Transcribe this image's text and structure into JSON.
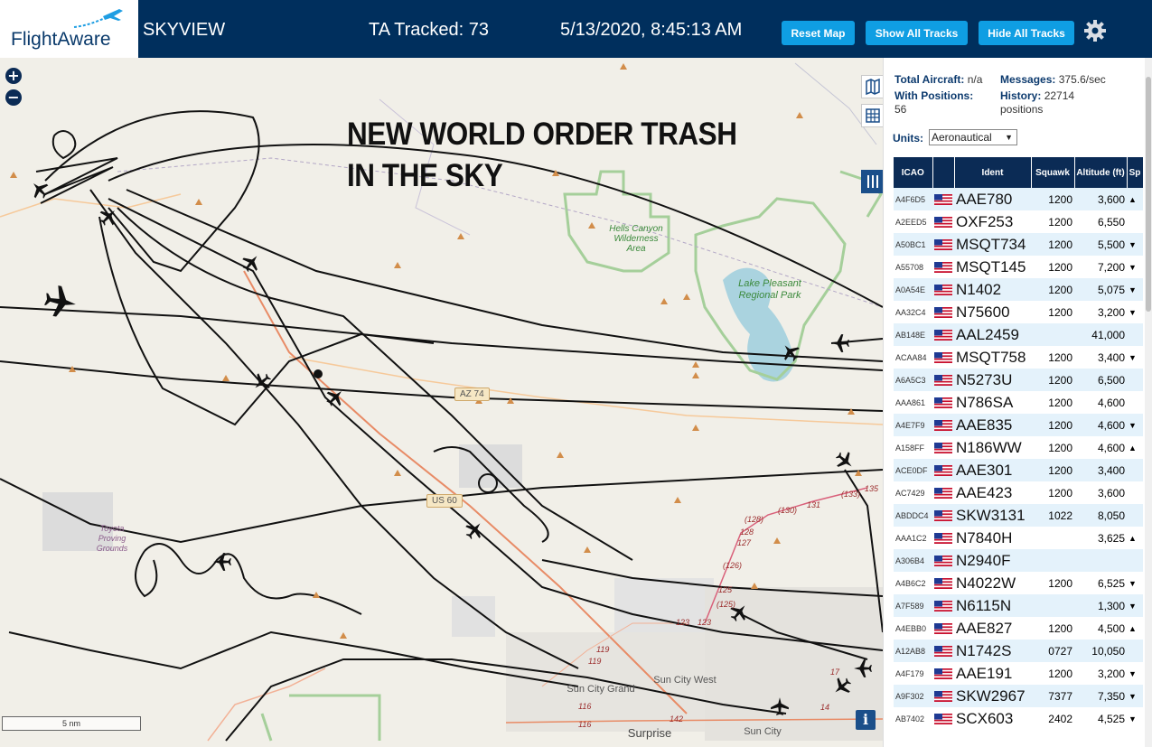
{
  "header": {
    "logo_text": "FlightAware",
    "app_title": "SKYVIEW",
    "tracked": "TA Tracked: 73",
    "datetime": "5/13/2020, 8:45:13 AM",
    "buttons": {
      "reset_map": "Reset Map",
      "show_all_tracks": "Show All Tracks",
      "hide_all_tracks": "Hide All Tracks"
    },
    "colors": {
      "bar": "#002f5d",
      "button": "#0f9ee3"
    }
  },
  "map": {
    "zoom_in": "+",
    "zoom_out": "−",
    "overlay_line1": "NEW WORLD ORDER TRASH",
    "overlay_line2": "IN THE SKY",
    "labels": {
      "hells_canyon": "Hells Canyon Wilderness Area",
      "lake_pleasant": "Lake Pleasant Regional Park",
      "toyota": "Toyota Proving Grounds",
      "sun_city_grand": "Sun City Grand",
      "sun_city_west": "Sun City West",
      "surprise": "Surprise",
      "sun_city": "Sun City"
    },
    "roads": {
      "az74": "AZ 74",
      "us60": "US 60"
    },
    "road_numbers": [
      "(133)",
      "(130)",
      "131",
      "(128)",
      "128",
      "127",
      "(126)",
      "125",
      "(125)",
      "123",
      "123",
      "119",
      "119",
      "116",
      "116",
      "142",
      "17",
      "14",
      "135"
    ],
    "scale": "5 nm",
    "info": "i",
    "icons": [
      "map-layer-icon",
      "grid-icon",
      "columns-icon",
      "airplane-icon"
    ]
  },
  "sidebar": {
    "total_aircraft_label": "Total Aircraft:",
    "total_aircraft_value": "n/a",
    "with_positions_label": "With Positions:",
    "with_positions_value": "56",
    "messages_label": "Messages:",
    "messages_value": "375.6/sec",
    "history_label": "History:",
    "history_value": "22714 positions",
    "units_label": "Units:",
    "units_value": "Aeronautical",
    "columns": [
      "ICAO",
      "",
      "Ident",
      "Squawk",
      "Altitude (ft)",
      "Sp"
    ],
    "rows": [
      {
        "icao": "A4F6D5",
        "ident": "AAE780",
        "squawk": "1200",
        "alt": "3,600",
        "trend": "▲"
      },
      {
        "icao": "A2EED5",
        "ident": "OXF253",
        "squawk": "1200",
        "alt": "6,550",
        "trend": ""
      },
      {
        "icao": "A50BC1",
        "ident": "MSQT734",
        "squawk": "1200",
        "alt": "5,500",
        "trend": "▼"
      },
      {
        "icao": "A55708",
        "ident": "MSQT145",
        "squawk": "1200",
        "alt": "7,200",
        "trend": "▼"
      },
      {
        "icao": "A0A54E",
        "ident": "N1402",
        "squawk": "1200",
        "alt": "5,075",
        "trend": "▼"
      },
      {
        "icao": "AA32C4",
        "ident": "N75600",
        "squawk": "1200",
        "alt": "3,200",
        "trend": "▼"
      },
      {
        "icao": "AB148E",
        "ident": "AAL2459",
        "squawk": "",
        "alt": "41,000",
        "trend": ""
      },
      {
        "icao": "ACAA84",
        "ident": "MSQT758",
        "squawk": "1200",
        "alt": "3,400",
        "trend": "▼"
      },
      {
        "icao": "A6A5C3",
        "ident": "N5273U",
        "squawk": "1200",
        "alt": "6,500",
        "trend": ""
      },
      {
        "icao": "AAA861",
        "ident": "N786SA",
        "squawk": "1200",
        "alt": "4,600",
        "trend": ""
      },
      {
        "icao": "A4E7F9",
        "ident": "AAE835",
        "squawk": "1200",
        "alt": "4,600",
        "trend": "▼"
      },
      {
        "icao": "A158FF",
        "ident": "N186WW",
        "squawk": "1200",
        "alt": "4,600",
        "trend": "▲"
      },
      {
        "icao": "ACE0DF",
        "ident": "AAE301",
        "squawk": "1200",
        "alt": "3,400",
        "trend": ""
      },
      {
        "icao": "AC7429",
        "ident": "AAE423",
        "squawk": "1200",
        "alt": "3,600",
        "trend": ""
      },
      {
        "icao": "ABDDC4",
        "ident": "SKW3131",
        "squawk": "1022",
        "alt": "8,050",
        "trend": ""
      },
      {
        "icao": "AAA1C2",
        "ident": "N7840H",
        "squawk": "",
        "alt": "3,625",
        "trend": "▲"
      },
      {
        "icao": "A306B4",
        "ident": "N2940F",
        "squawk": "",
        "alt": "",
        "trend": ""
      },
      {
        "icao": "A4B6C2",
        "ident": "N4022W",
        "squawk": "1200",
        "alt": "6,525",
        "trend": "▼"
      },
      {
        "icao": "A7F589",
        "ident": "N6115N",
        "squawk": "",
        "alt": "1,300",
        "trend": "▼"
      },
      {
        "icao": "A4EBB0",
        "ident": "AAE827",
        "squawk": "1200",
        "alt": "4,500",
        "trend": "▲"
      },
      {
        "icao": "A12AB8",
        "ident": "N1742S",
        "squawk": "0727",
        "alt": "10,050",
        "trend": ""
      },
      {
        "icao": "A4F179",
        "ident": "AAE191",
        "squawk": "1200",
        "alt": "3,200",
        "trend": "▼"
      },
      {
        "icao": "A9F302",
        "ident": "SKW2967",
        "squawk": "7377",
        "alt": "7,350",
        "trend": "▼"
      },
      {
        "icao": "AB7402",
        "ident": "SCX603",
        "squawk": "2402",
        "alt": "4,525",
        "trend": "▼"
      }
    ]
  }
}
